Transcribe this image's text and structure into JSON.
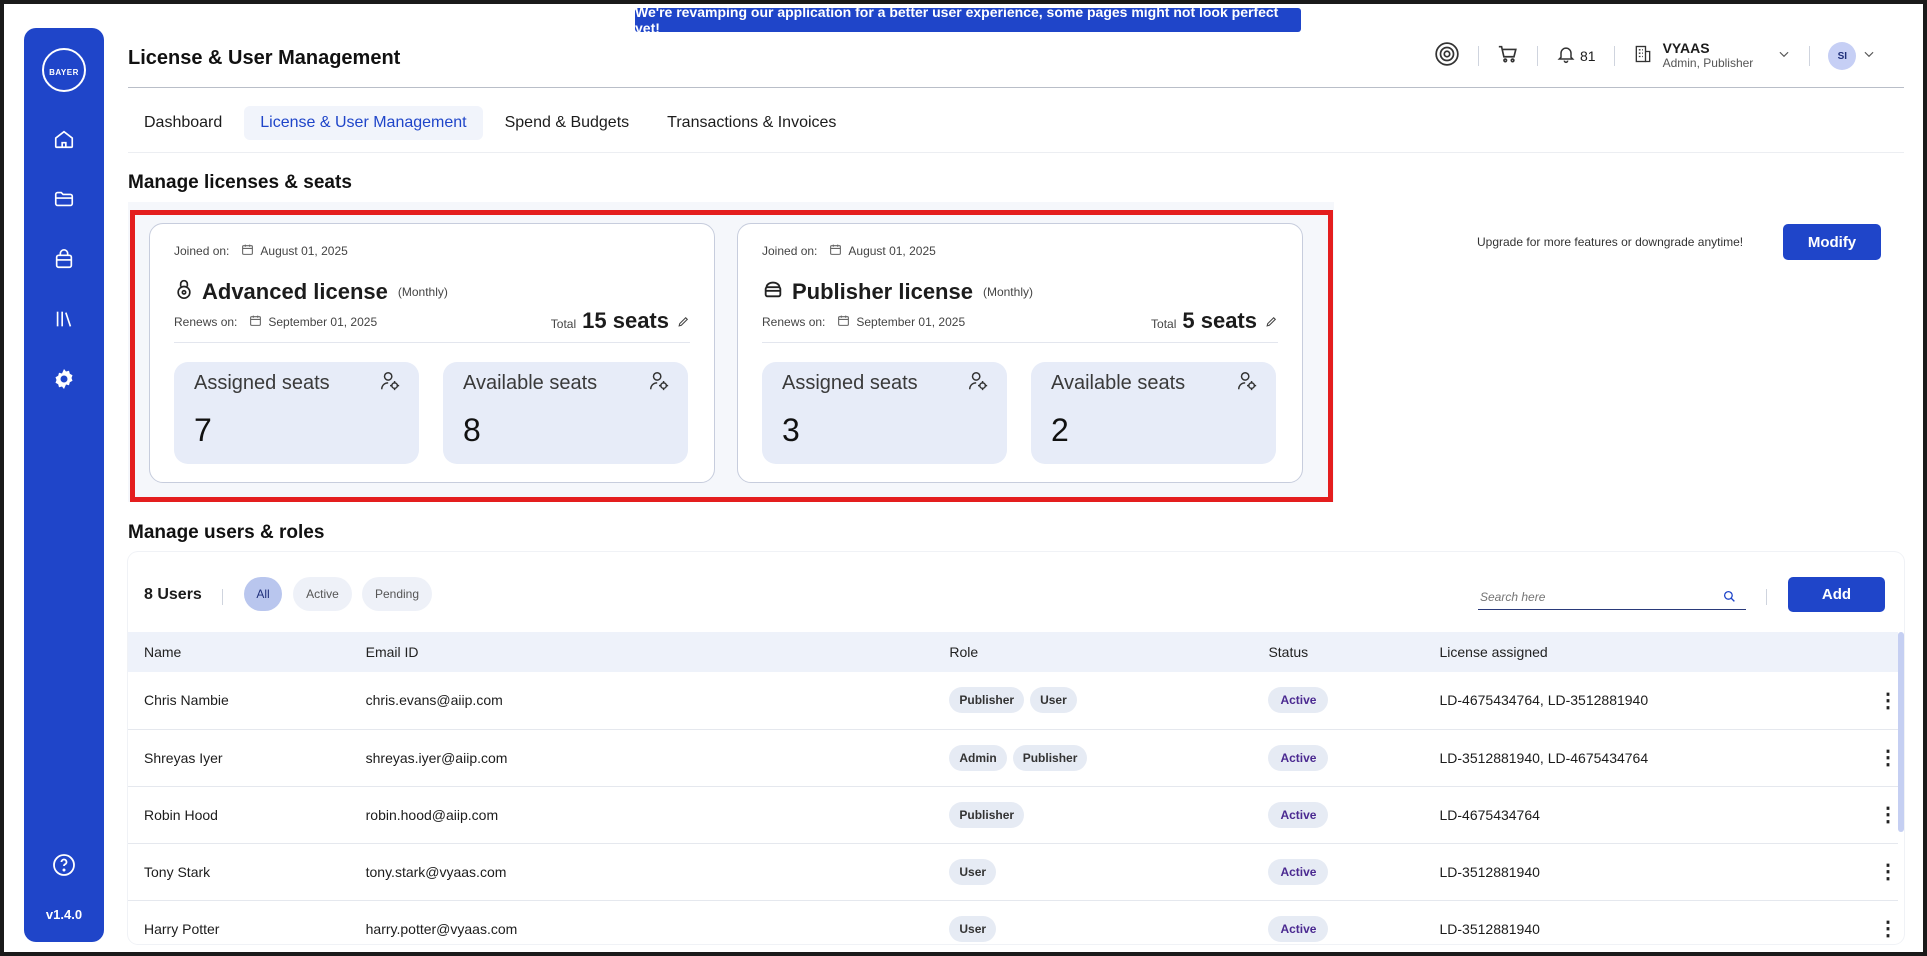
{
  "banner": "We're revamping our application for a better user experience, some pages might not look perfect yet!",
  "sidebar": {
    "logo_text_h": "BAYER",
    "logo_text_v": "BAYER",
    "items": [
      "home-icon",
      "folder-icon",
      "bag-icon",
      "library-icon",
      "settings-icon"
    ],
    "help_icon": "help-icon",
    "version": "v1.4.0"
  },
  "header": {
    "title": "License & User Management",
    "notifications_count": "81",
    "company_name": "VYAAS",
    "company_role": "Admin, Publisher",
    "avatar_initials": "SI"
  },
  "tabs": [
    {
      "label": "Dashboard",
      "active": false
    },
    {
      "label": "License & User Management",
      "active": true
    },
    {
      "label": "Spend & Budgets",
      "active": false
    },
    {
      "label": "Transactions & Invoices",
      "active": false
    }
  ],
  "licenses_section": {
    "title": "Manage licenses & seats",
    "upgrade_text": "Upgrade for more features or downgrade anytime!",
    "modify_label": "Modify",
    "cards": [
      {
        "joined_label": "Joined on:",
        "joined_date": "August 01, 2025",
        "name": "Advanced license",
        "frequency": "(Monthly)",
        "renews_label": "Renews on:",
        "renews_date": "September 01, 2025",
        "total_label": "Total",
        "total_seats": "15 seats",
        "assigned_label": "Assigned seats",
        "assigned_value": "7",
        "available_label": "Available seats",
        "available_value": "8"
      },
      {
        "joined_label": "Joined on:",
        "joined_date": "August 01, 2025",
        "name": "Publisher license",
        "frequency": "(Monthly)",
        "renews_label": "Renews on:",
        "renews_date": "September 01, 2025",
        "total_label": "Total",
        "total_seats": "5 seats",
        "assigned_label": "Assigned seats",
        "assigned_value": "3",
        "available_label": "Available seats",
        "available_value": "2"
      }
    ]
  },
  "users_section": {
    "title": "Manage users & roles",
    "count_label": "8 Users",
    "filters": [
      "All",
      "Active",
      "Pending"
    ],
    "search_placeholder": "Search here",
    "add_label": "Add",
    "columns": [
      "Name",
      "Email ID",
      "Role",
      "Status",
      "License assigned"
    ],
    "rows": [
      {
        "name": "Chris Nambie",
        "email": "chris.evans@aiip.com",
        "roles": [
          "Publisher",
          "User"
        ],
        "status": "Active",
        "license": "LD-4675434764, LD-3512881940"
      },
      {
        "name": "Shreyas Iyer",
        "email": "shreyas.iyer@aiip.com",
        "roles": [
          "Admin",
          "Publisher"
        ],
        "status": "Active",
        "license": "LD-3512881940, LD-4675434764"
      },
      {
        "name": "Robin Hood",
        "email": "robin.hood@aiip.com",
        "roles": [
          "Publisher"
        ],
        "status": "Active",
        "license": "LD-4675434764"
      },
      {
        "name": "Tony Stark",
        "email": "tony.stark@vyaas.com",
        "roles": [
          "User"
        ],
        "status": "Active",
        "license": "LD-3512881940"
      },
      {
        "name": "Harry Potter",
        "email": "harry.potter@vyaas.com",
        "roles": [
          "User"
        ],
        "status": "Active",
        "license": "LD-3512881940"
      }
    ]
  },
  "colors": {
    "brand": "#1f45c9",
    "highlight": "#e41e1e",
    "status_text": "#4b2a91"
  }
}
